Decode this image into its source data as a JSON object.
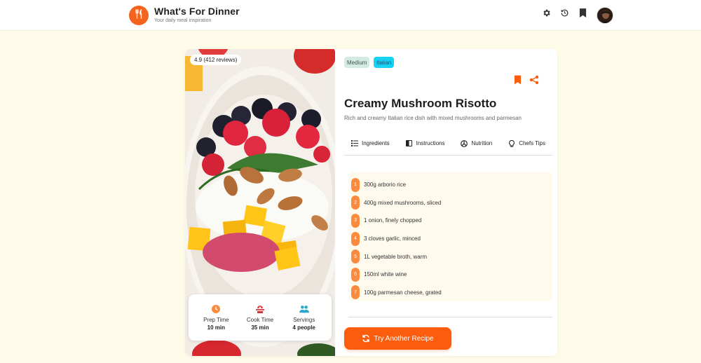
{
  "header": {
    "title": "What's For Dinner",
    "subtitle": "Your daily meal inspiration",
    "icons": [
      "gear-icon",
      "history-icon",
      "bookmark-icon"
    ]
  },
  "recipe": {
    "rating": "4.9 (412 reviews)",
    "tags": [
      "Medium",
      "Italian"
    ],
    "title": "Creamy Mushroom Risotto",
    "description": "Rich and creamy Italian rice dish with mixed mushrooms and parmesan",
    "stats": [
      {
        "label": "Prep Time",
        "value": "10 min",
        "icon": "clock-icon"
      },
      {
        "label": "Cook Time",
        "value": "35 min",
        "icon": "cooking-pot-icon"
      },
      {
        "label": "Servings",
        "value": "4 people",
        "icon": "people-icon"
      }
    ]
  },
  "tabs": [
    {
      "label": "Ingredients",
      "icon": "list-icon"
    },
    {
      "label": "Instructions",
      "icon": "book-icon"
    },
    {
      "label": "Nutrition",
      "icon": "nutrition-icon"
    },
    {
      "label": "Chefs Tips",
      "icon": "lightbulb-icon"
    }
  ],
  "ingredients": [
    {
      "num": "1",
      "text": "300g arborio rice"
    },
    {
      "num": "2",
      "text": "400g mixed mushrooms, sliced"
    },
    {
      "num": "3",
      "text": "1 onion, finely chopped"
    },
    {
      "num": "4",
      "text": "3 cloves garlic, minced"
    },
    {
      "num": "5",
      "text": "1L vegetable broth, warm"
    },
    {
      "num": "6",
      "text": "150ml white wine"
    },
    {
      "num": "7",
      "text": "100g parmesan cheese, grated"
    }
  ],
  "cta": {
    "label": "Try Another Recipe",
    "icon": "refresh-icon"
  },
  "colors": {
    "accent": "#fb5c0d",
    "background": "#fffbe9",
    "tag_medium": "#d4ebe3",
    "tag_italian": "#16d2f5"
  }
}
